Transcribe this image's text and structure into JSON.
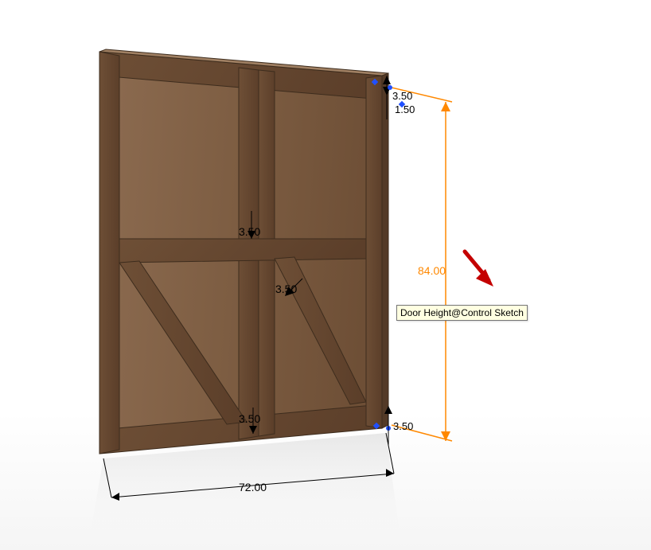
{
  "dimensions": {
    "width": "72.00",
    "height": "84.00",
    "rail": "3.50",
    "mid_rail": "3.50",
    "brace": "3.50",
    "bottom_rail": "3.50",
    "top_small_1": "3.50",
    "top_small_2": "1.50",
    "bottom_small": "3.50"
  },
  "tooltip": "Door Height@Control Sketch"
}
